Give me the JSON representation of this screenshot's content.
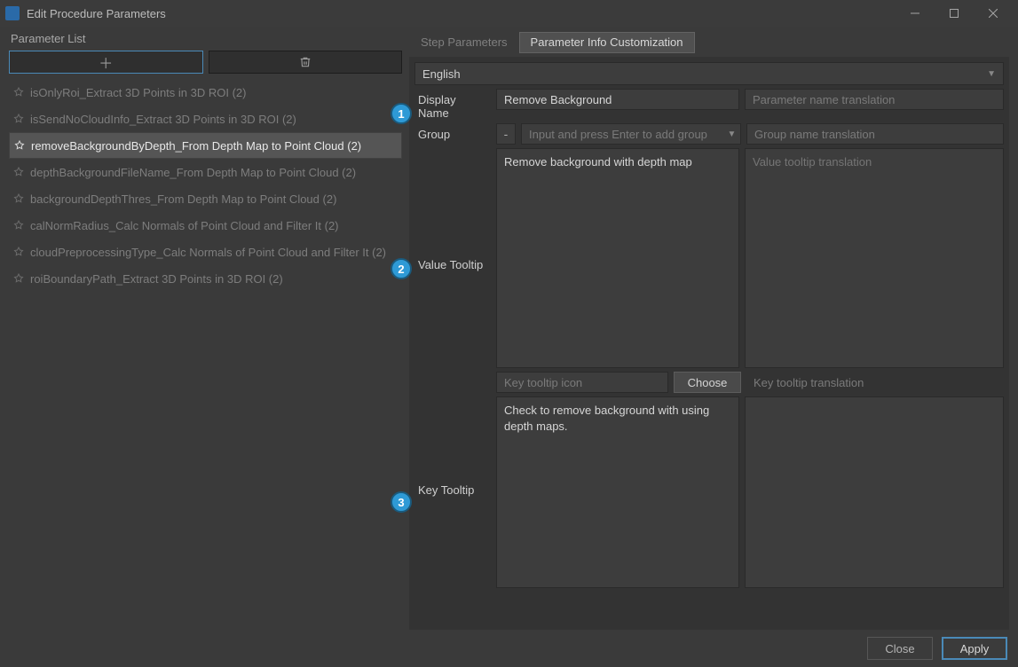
{
  "window": {
    "title": "Edit Procedure Parameters"
  },
  "left": {
    "header": "Parameter List",
    "items": [
      "isOnlyRoi_Extract 3D Points in 3D ROI (2)",
      "isSendNoCloudInfo_Extract 3D Points in 3D ROI (2)",
      "removeBackgroundByDepth_From Depth Map to Point Cloud (2)",
      "depthBackgroundFileName_From Depth Map to Point Cloud (2)",
      "backgroundDepthThres_From Depth Map to Point Cloud (2)",
      "calNormRadius_Calc Normals of Point Cloud and Filter It (2)",
      "cloudPreprocessingType_Calc Normals of Point Cloud and Filter It (2)",
      "roiBoundaryPath_Extract 3D Points in 3D ROI (2)"
    ],
    "selected_index": 2
  },
  "tabs": {
    "step": "Step Parameters",
    "info": "Parameter Info Customization"
  },
  "form": {
    "language": "English",
    "display_name_label": "Display Name",
    "display_name_value": "Remove Background",
    "display_name_trans_ph": "Parameter name translation",
    "group_label": "Group",
    "group_minus": "-",
    "group_ph": "Input and press Enter to add group",
    "group_trans_ph": "Group name translation",
    "value_tooltip_label": "Value Tooltip",
    "value_tooltip_text": "Remove background with depth map",
    "value_tooltip_trans_ph": "Value tooltip translation",
    "key_icon_ph": "Key tooltip icon",
    "choose": "Choose",
    "key_tooltip_label": "Key Tooltip",
    "key_tooltip_text": "Check to remove background with using depth maps.",
    "key_tooltip_trans_ph": "Key tooltip translation"
  },
  "footer": {
    "close": "Close",
    "apply": "Apply"
  },
  "annotations": {
    "a1": "1",
    "a2": "2",
    "a3": "3"
  }
}
